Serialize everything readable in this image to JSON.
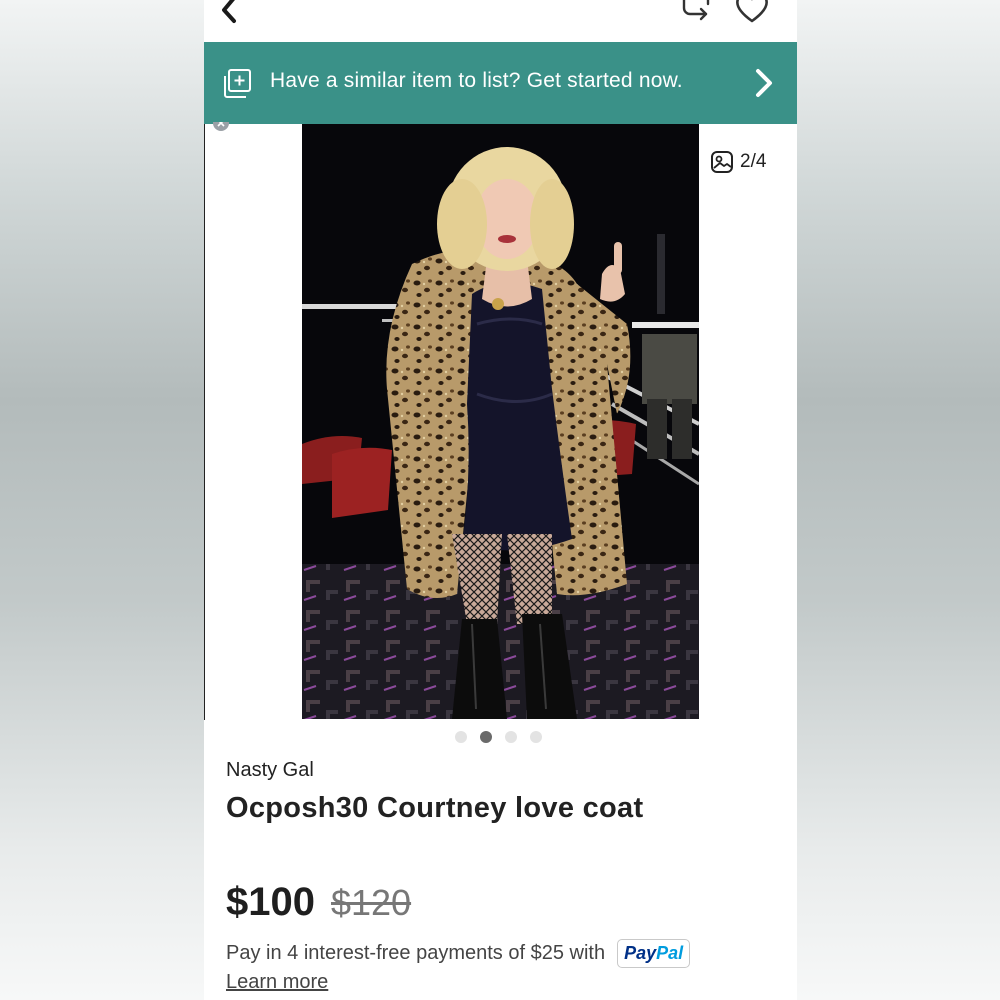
{
  "banner": {
    "text": "Have a similar item to list? Get started now.",
    "icon": "add-listing-icon"
  },
  "gallery": {
    "counter": "2/4",
    "current_index": 2,
    "total": 4
  },
  "listing": {
    "brand": "Nasty Gal",
    "title": "Ocposh30 Courtney love coat",
    "price": "$100",
    "original_price": "$120"
  },
  "payment": {
    "text": "Pay in 4 interest-free payments of $25 with",
    "provider_part1": "Pay",
    "provider_part2": "Pal",
    "learn_more": "Learn more"
  },
  "colors": {
    "banner_bg": "#3a9188",
    "paypal_dark": "#003087",
    "paypal_light": "#009cde"
  },
  "icons": [
    "back-chevron-icon",
    "share-icon",
    "heart-icon",
    "add-listing-icon",
    "chevron-right-icon",
    "photo-icon"
  ]
}
